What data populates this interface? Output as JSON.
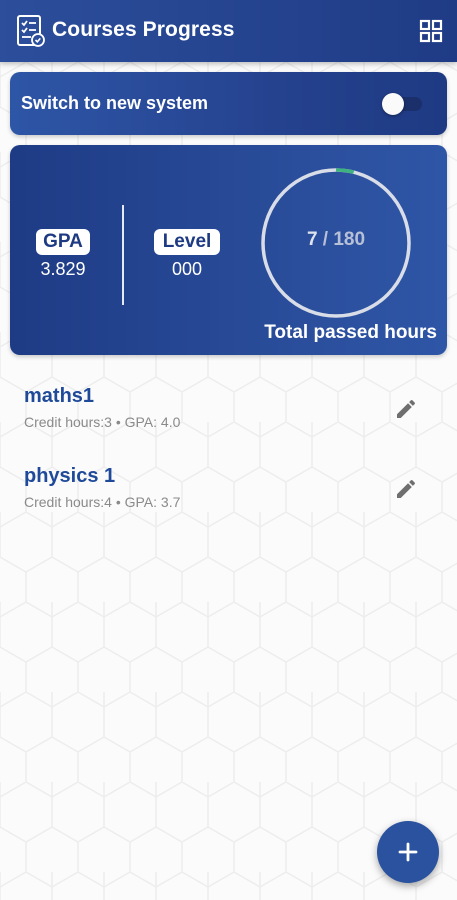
{
  "app_bar": {
    "title": "Courses Progress",
    "logo_icon": "checklist-document-icon",
    "menu_icon": "grid-view-icon"
  },
  "system_switch": {
    "label": "Switch to new system",
    "enabled": false
  },
  "stats": {
    "gpa_label": "GPA",
    "gpa_value": "3.829",
    "level_label": "Level",
    "level_value": "000",
    "passed_hours": "7",
    "separator": " / ",
    "total_hours": "180",
    "progress_fraction": 0.039,
    "caption": "Total passed hours"
  },
  "courses": [
    {
      "name": "maths1",
      "details": "Credit hours:3 • GPA: 4.0"
    },
    {
      "name": "physics 1",
      "details": "Credit hours:4 • GPA: 3.7"
    }
  ],
  "fab_icon": "plus-icon",
  "colors": {
    "primary": "#1e3a83",
    "accent": "#2a529f",
    "progress": "#3fb37f",
    "course_title": "#1f4a9a"
  }
}
